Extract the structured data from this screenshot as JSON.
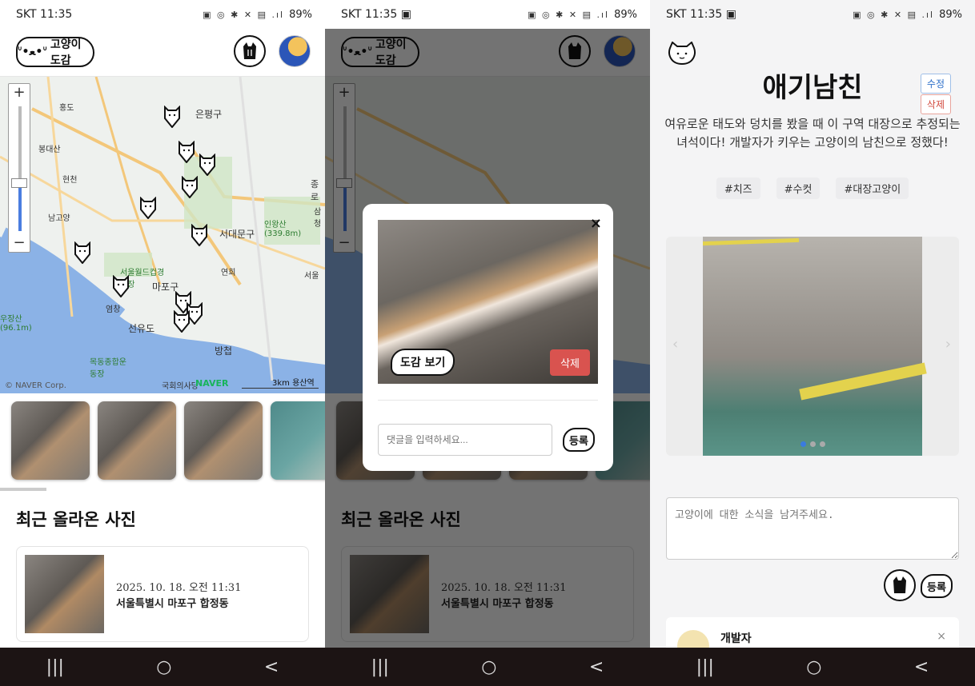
{
  "status": {
    "time": "SKT 11:35",
    "battery": "89%"
  },
  "app": {
    "logo_text": "고양이 도감"
  },
  "map": {
    "labels": [
      {
        "text": "은평구"
      },
      {
        "text": "홍도"
      },
      {
        "text": "봉대산"
      },
      {
        "text": "현천"
      },
      {
        "text": "남고양"
      },
      {
        "text": "서대문구"
      },
      {
        "text": "인왕산 (339.8m)"
      },
      {
        "text": "서울월드컵경기장"
      },
      {
        "text": "마포구"
      },
      {
        "text": "연희"
      },
      {
        "text": "염창"
      },
      {
        "text": "선유도"
      },
      {
        "text": "방첩"
      },
      {
        "text": "우장산 (96.1m)"
      },
      {
        "text": "목동종합운동장"
      },
      {
        "text": "국회의사당"
      },
      {
        "text": "서울"
      },
      {
        "text": "종로"
      },
      {
        "text": "삼청"
      }
    ],
    "zoom_in": "+",
    "zoom_out": "−",
    "copyright": "© NAVER Corp.",
    "brand": "NAVER",
    "scale": "3km",
    "scale_place": "용산역"
  },
  "section_title": "최근 올라온 사진",
  "recent": {
    "date": "2025. 10. 18. 오전 11:31",
    "address": "서울특별시 마포구 합정동"
  },
  "modal": {
    "dogam_button": "도감 보기",
    "delete_button": "삭제",
    "comment_placeholder": "댓글을 입력하세요...",
    "register_button": "등록",
    "close": "×"
  },
  "detail": {
    "name": "애기남친",
    "edit": "수정",
    "delete": "삭제",
    "description": "여유로운 태도와 덩치를 봤을 때 이 구역 대장으로 추정되는 녀석이다! 개발자가 키우는 고양이의 남친으로 정했다!",
    "tags": [
      "#치즈",
      "#수컷",
      "#대장고양이"
    ],
    "news_placeholder": "고양이에 대한 소식을 남겨주세요.",
    "register_button": "등록",
    "comment_author": "개발자",
    "comment_close": "×",
    "prev": "‹",
    "next": "›"
  },
  "nav": {
    "recent": "|||",
    "home": "○",
    "back": "<"
  }
}
